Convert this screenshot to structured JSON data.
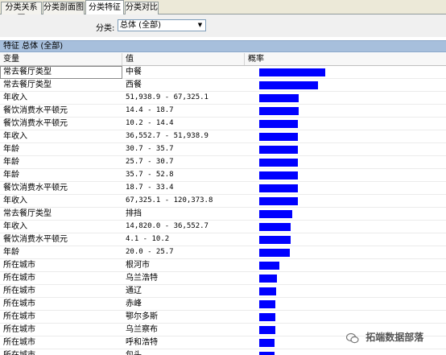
{
  "tabs": [
    {
      "label": "分类关系图",
      "active": false
    },
    {
      "label": "分类剖面图",
      "active": false
    },
    {
      "label": "分类特征",
      "active": true
    },
    {
      "label": "分类对比",
      "active": false
    }
  ],
  "filter": {
    "label": "分类:",
    "selected": "总体 (全部)"
  },
  "section_header": "特征 总体 (全部)",
  "columns": {
    "variable": "变量",
    "value": "值",
    "probability": "概率"
  },
  "rows": [
    {
      "variable": "常去餐厅类型",
      "value": "中餐",
      "probability": 0.85,
      "mono": false
    },
    {
      "variable": "常去餐厅类型",
      "value": "西餐",
      "probability": 0.76,
      "mono": false
    },
    {
      "variable": "年收入",
      "value": "51,938.9 - 67,325.1",
      "probability": 0.51,
      "mono": true
    },
    {
      "variable": "餐饮消费水平顿元",
      "value": "14.4 - 18.7",
      "probability": 0.51,
      "mono": true
    },
    {
      "variable": "餐饮消费水平顿元",
      "value": "10.2 - 14.4",
      "probability": 0.5,
      "mono": true
    },
    {
      "variable": "年收入",
      "value": "36,552.7 - 51,938.9",
      "probability": 0.5,
      "mono": true
    },
    {
      "variable": "年龄",
      "value": "30.7 - 35.7",
      "probability": 0.5,
      "mono": true
    },
    {
      "variable": "年龄",
      "value": "25.7 - 30.7",
      "probability": 0.5,
      "mono": true
    },
    {
      "variable": "年龄",
      "value": "35.7 - 52.8",
      "probability": 0.5,
      "mono": true
    },
    {
      "variable": "餐饮消费水平顿元",
      "value": "18.7 - 33.4",
      "probability": 0.5,
      "mono": true
    },
    {
      "variable": "年收入",
      "value": "67,325.1 - 120,373.8",
      "probability": 0.5,
      "mono": true
    },
    {
      "variable": "常去餐厅类型",
      "value": "排挡",
      "probability": 0.43,
      "mono": false
    },
    {
      "variable": "年收入",
      "value": "14,820.0 - 36,552.7",
      "probability": 0.41,
      "mono": true
    },
    {
      "variable": "餐饮消费水平顿元",
      "value": "4.1 - 10.2",
      "probability": 0.41,
      "mono": true
    },
    {
      "variable": "年龄",
      "value": "20.0 - 25.7",
      "probability": 0.4,
      "mono": true
    },
    {
      "variable": "所在城市",
      "value": "根河市",
      "probability": 0.26,
      "mono": false
    },
    {
      "variable": "所在城市",
      "value": "乌兰浩特",
      "probability": 0.23,
      "mono": false
    },
    {
      "variable": "所在城市",
      "value": "通辽",
      "probability": 0.22,
      "mono": false
    },
    {
      "variable": "所在城市",
      "value": "赤峰",
      "probability": 0.21,
      "mono": false
    },
    {
      "variable": "所在城市",
      "value": "鄂尔多斯",
      "probability": 0.21,
      "mono": false
    },
    {
      "variable": "所在城市",
      "value": "乌兰察布",
      "probability": 0.21,
      "mono": false
    },
    {
      "variable": "所在城市",
      "value": "呼和浩特",
      "probability": 0.2,
      "mono": false
    },
    {
      "variable": "所在城市",
      "value": "包头",
      "probability": 0.2,
      "mono": false
    }
  ],
  "bar_color": "#0000ff",
  "watermark": "拓端数据部落"
}
